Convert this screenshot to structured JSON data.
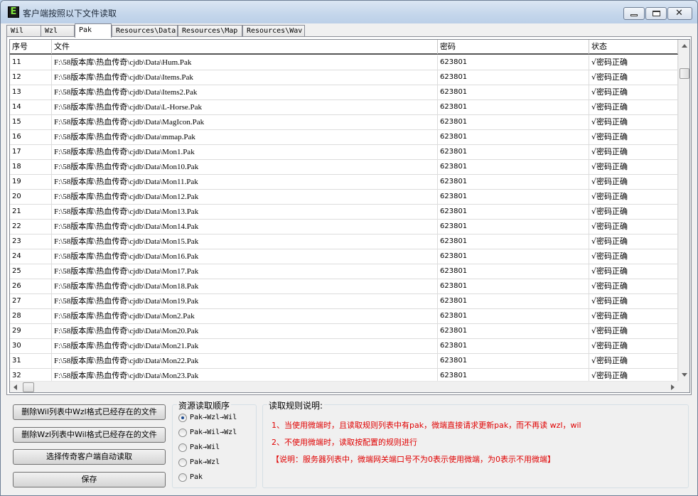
{
  "window": {
    "app_icon": "E",
    "title": "客户端按照以下文件读取",
    "close_glyph": "✕"
  },
  "tabs": [
    {
      "label": "Wil",
      "active": false
    },
    {
      "label": "Wzl",
      "active": false
    },
    {
      "label": "Pak",
      "active": true
    },
    {
      "label": "Resources\\Data",
      "active": false
    },
    {
      "label": "Resources\\Map",
      "active": false
    },
    {
      "label": "Resources\\Wav",
      "active": false
    }
  ],
  "table": {
    "columns": [
      "序号",
      "文件",
      "密码",
      "状态"
    ],
    "rows": [
      [
        "11",
        "F:\\58版本库\\热血传奇\\cjdb\\Data\\Hum.Pak",
        "623801",
        "√密码正确"
      ],
      [
        "12",
        "F:\\58版本库\\热血传奇\\cjdb\\Data\\Items.Pak",
        "623801",
        "√密码正确"
      ],
      [
        "13",
        "F:\\58版本库\\热血传奇\\cjdb\\Data\\Items2.Pak",
        "623801",
        "√密码正确"
      ],
      [
        "14",
        "F:\\58版本库\\热血传奇\\cjdb\\Data\\L-Horse.Pak",
        "623801",
        "√密码正确"
      ],
      [
        "15",
        "F:\\58版本库\\热血传奇\\cjdb\\Data\\MagIcon.Pak",
        "623801",
        "√密码正确"
      ],
      [
        "16",
        "F:\\58版本库\\热血传奇\\cjdb\\Data\\mmap.Pak",
        "623801",
        "√密码正确"
      ],
      [
        "17",
        "F:\\58版本库\\热血传奇\\cjdb\\Data\\Mon1.Pak",
        "623801",
        "√密码正确"
      ],
      [
        "18",
        "F:\\58版本库\\热血传奇\\cjdb\\Data\\Mon10.Pak",
        "623801",
        "√密码正确"
      ],
      [
        "19",
        "F:\\58版本库\\热血传奇\\cjdb\\Data\\Mon11.Pak",
        "623801",
        "√密码正确"
      ],
      [
        "20",
        "F:\\58版本库\\热血传奇\\cjdb\\Data\\Mon12.Pak",
        "623801",
        "√密码正确"
      ],
      [
        "21",
        "F:\\58版本库\\热血传奇\\cjdb\\Data\\Mon13.Pak",
        "623801",
        "√密码正确"
      ],
      [
        "22",
        "F:\\58版本库\\热血传奇\\cjdb\\Data\\Mon14.Pak",
        "623801",
        "√密码正确"
      ],
      [
        "23",
        "F:\\58版本库\\热血传奇\\cjdb\\Data\\Mon15.Pak",
        "623801",
        "√密码正确"
      ],
      [
        "24",
        "F:\\58版本库\\热血传奇\\cjdb\\Data\\Mon16.Pak",
        "623801",
        "√密码正确"
      ],
      [
        "25",
        "F:\\58版本库\\热血传奇\\cjdb\\Data\\Mon17.Pak",
        "623801",
        "√密码正确"
      ],
      [
        "26",
        "F:\\58版本库\\热血传奇\\cjdb\\Data\\Mon18.Pak",
        "623801",
        "√密码正确"
      ],
      [
        "27",
        "F:\\58版本库\\热血传奇\\cjdb\\Data\\Mon19.Pak",
        "623801",
        "√密码正确"
      ],
      [
        "28",
        "F:\\58版本库\\热血传奇\\cjdb\\Data\\Mon2.Pak",
        "623801",
        "√密码正确"
      ],
      [
        "29",
        "F:\\58版本库\\热血传奇\\cjdb\\Data\\Mon20.Pak",
        "623801",
        "√密码正确"
      ],
      [
        "30",
        "F:\\58版本库\\热血传奇\\cjdb\\Data\\Mon21.Pak",
        "623801",
        "√密码正确"
      ],
      [
        "31",
        "F:\\58版本库\\热血传奇\\cjdb\\Data\\Mon22.Pak",
        "623801",
        "√密码正确"
      ],
      [
        "32",
        "F:\\58版本库\\热血传奇\\cjdb\\Data\\Mon23.Pak",
        "623801",
        "√密码正确"
      ]
    ]
  },
  "actions": {
    "delete_wil": "删除Wil列表中Wzl格式已经存在的文件",
    "delete_wzl": "删除Wzl列表中Wil格式已经存在的文件",
    "auto_read": "选择传奇客户端自动读取",
    "save": "保存"
  },
  "read_order": {
    "label": "资源读取顺序",
    "options": [
      {
        "label": "Pak→Wzl→Wil",
        "selected": true
      },
      {
        "label": "Pak→Wil→Wzl",
        "selected": false
      },
      {
        "label": "Pak→Wil",
        "selected": false
      },
      {
        "label": "Pak→Wzl",
        "selected": false
      },
      {
        "label": "Pak",
        "selected": false
      }
    ]
  },
  "rules": {
    "label": "读取规则说明:",
    "lines": [
      "1、当使用微端时，且读取规则列表中有pak，微端直接请求更新pak，而不再读 wzl，wil",
      "2、不使用微端时，读取按配置的规则进行",
      "【说明：服务器列表中，微端网关端口号不为0表示使用微端，为0表示不用微端】"
    ],
    "text_color": "#e00000"
  }
}
